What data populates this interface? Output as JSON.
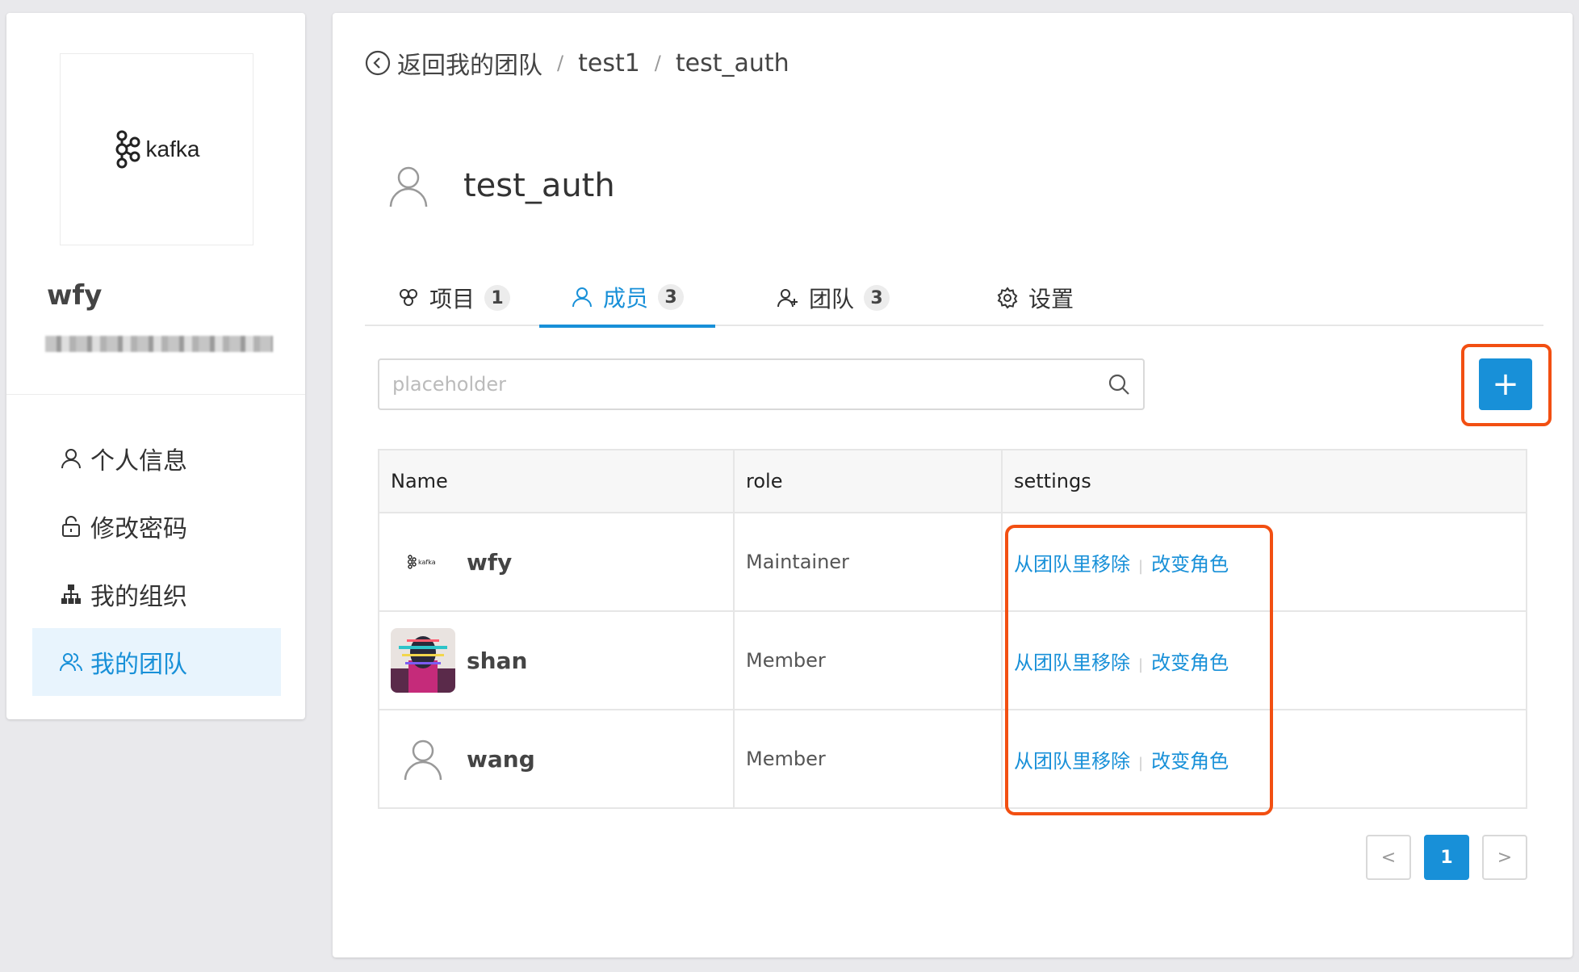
{
  "sidebar": {
    "logo_text": "kafka",
    "username": "wfy",
    "nav": [
      {
        "label": "个人信息",
        "icon": "user-icon"
      },
      {
        "label": "修改密码",
        "icon": "lock-icon"
      },
      {
        "label": "我的组织",
        "icon": "org-icon"
      },
      {
        "label": "我的团队",
        "icon": "team-icon",
        "active": true
      }
    ]
  },
  "breadcrumb": {
    "back_label": "返回我的团队",
    "items": [
      "test1",
      "test_auth"
    ],
    "separator": "/"
  },
  "team": {
    "title": "test_auth"
  },
  "tabs": [
    {
      "label": "项目",
      "count": "1",
      "icon": "project-icon"
    },
    {
      "label": "成员",
      "count": "3",
      "icon": "member-icon",
      "active": true
    },
    {
      "label": "团队",
      "count": "3",
      "icon": "team-add-icon"
    },
    {
      "label": "设置",
      "icon": "gear-icon"
    }
  ],
  "search": {
    "placeholder": "placeholder"
  },
  "add_button": {
    "label": "+"
  },
  "table": {
    "columns": [
      "Name",
      "role",
      "settings"
    ],
    "rows": [
      {
        "name": "wfy",
        "role": "Maintainer",
        "avatar": "kafka-logo"
      },
      {
        "name": "shan",
        "role": "Member",
        "avatar": "image"
      },
      {
        "name": "wang",
        "role": "Member",
        "avatar": "default-user-icon"
      }
    ],
    "actions": {
      "remove": "从团队里移除",
      "change_role": "改变角色"
    }
  },
  "pagination": {
    "prev": "<",
    "current": "1",
    "next": ">"
  },
  "colors": {
    "accent": "#1890d8",
    "highlight": "#f24f12"
  }
}
